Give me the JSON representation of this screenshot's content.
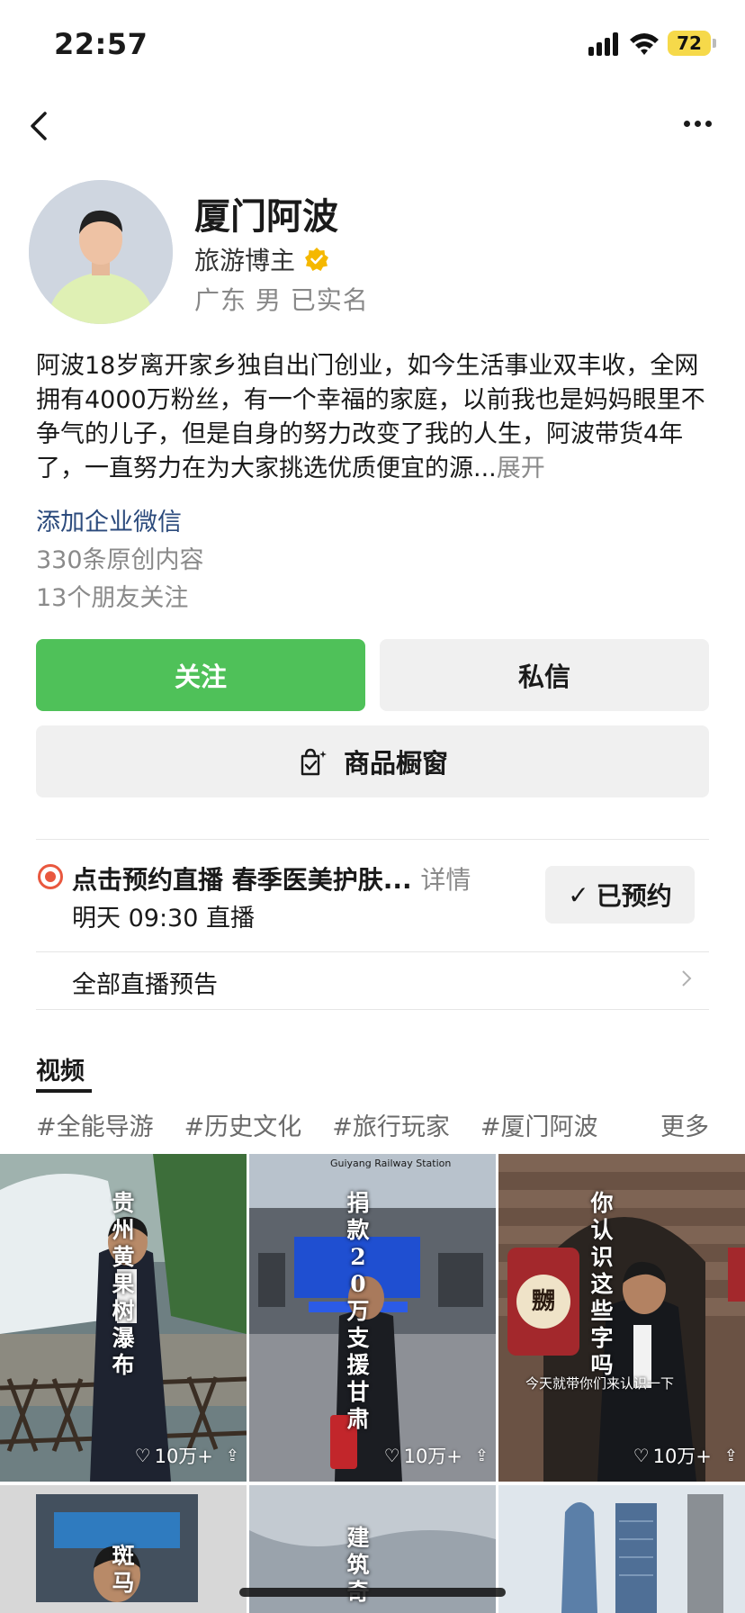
{
  "status_bar": {
    "time": "22:57",
    "battery": "72"
  },
  "profile": {
    "name": "厦门阿波",
    "role": "旅游博主",
    "meta": "广东 男 已实名",
    "bio": "阿波18岁离开家乡独自出门创业，如今生活事业双丰收，全网拥有4000万粉丝，有一个幸福的家庭，以前我也是妈妈眼里不争气的儿子，但是自身的努力改变了我的人生，阿波带货4年了，一直努力在为大家挑选优质便宜的源...",
    "bio_expand": "展开",
    "wechat_link": "添加企业微信",
    "original_count": "330条原创内容",
    "friends_follow": "13个朋友关注"
  },
  "actions": {
    "follow": "关注",
    "message": "私信",
    "shop": "商品橱窗"
  },
  "live": {
    "title": "点击预约直播 春季医美护肤...",
    "detail": "详情",
    "time": "明天 09:30 直播",
    "reserved": "已预约",
    "all_previews": "全部直播预告"
  },
  "tabs": {
    "video": "视频"
  },
  "tags": [
    "#全能导游",
    "#历史文化",
    "#旅行玩家",
    "#厦门阿波"
  ],
  "tags_more": "更多",
  "videos": [
    {
      "title": "贵州黄果树瀑布",
      "likes": "10万+"
    },
    {
      "title": "捐款20万支援甘肃",
      "likes": "10万+",
      "sign": "Guiyang Railway Station"
    },
    {
      "title": "你认识这些字吗",
      "likes": "10万+",
      "caption": "今天就带你们来认识一下",
      "sign": "嬲"
    },
    {
      "title": "斑马"
    },
    {
      "title": "建筑奇"
    },
    {
      "title": ""
    }
  ],
  "colors": {
    "follow_green": "#4fc159",
    "live_red": "#e9583f",
    "link_blue": "#2b4a7c",
    "verified_gold": "#f5b800"
  }
}
